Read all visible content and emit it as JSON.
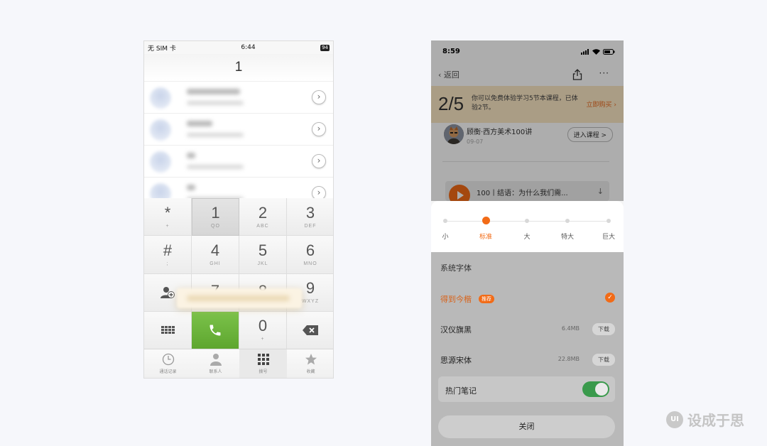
{
  "left_phone": {
    "status_bar": {
      "carrier": "无 SIM 卡",
      "time": "6:44",
      "battery": "94"
    },
    "dialed_number": "1",
    "keys": [
      {
        "num": "*",
        "sub": "+"
      },
      {
        "num": "1",
        "sub": "QO"
      },
      {
        "num": "2",
        "sub": "ABC"
      },
      {
        "num": "3",
        "sub": "DEF"
      },
      {
        "num": "#",
        "sub": ";"
      },
      {
        "num": "4",
        "sub": "GHI"
      },
      {
        "num": "5",
        "sub": "JKL"
      },
      {
        "num": "6",
        "sub": "MNO"
      },
      {
        "num": "",
        "sub": ""
      },
      {
        "num": "7",
        "sub": ""
      },
      {
        "num": "8",
        "sub": ""
      },
      {
        "num": "9",
        "sub": "WXYZ"
      },
      {
        "num": "",
        "sub": ""
      },
      {
        "num": "",
        "sub": ""
      },
      {
        "num": "0",
        "sub": "+"
      },
      {
        "num": "",
        "sub": ""
      }
    ],
    "tabs": [
      "通话记录",
      "联系人",
      "拨号",
      "收藏"
    ],
    "call_color": "#66ad35"
  },
  "right_phone": {
    "status_bar": {
      "time": "8:59"
    },
    "nav": {
      "back_label": "返回",
      "more_label": "···"
    },
    "trial_banner": {
      "count": "2/5",
      "text": "你可以免费体验学习5节本课程，已体验2节。",
      "buy_label": "立即购买"
    },
    "course": {
      "title": "顾衡·西方美术100讲",
      "date": "09-07",
      "enter_label": "进入课程 >"
    },
    "audio": {
      "title": "100丨结语：为什么我们需..."
    },
    "font_sizes": {
      "options": [
        "小",
        "标准",
        "大",
        "特大",
        "巨大"
      ],
      "selected": "标准"
    },
    "system_font_label": "系统字体",
    "fonts": [
      {
        "name": "得到今楷",
        "badge": "推荐",
        "size": "",
        "action": ""
      },
      {
        "name": "汉仪旗黑",
        "badge": "",
        "size": "6.4MB",
        "action": "下载"
      },
      {
        "name": "思源宋体",
        "badge": "",
        "size": "22.8MB",
        "action": "下载"
      }
    ],
    "hot_notes": {
      "label": "热门笔记",
      "enabled": true
    },
    "close_label": "关闭",
    "accent_color": "#f26b17"
  },
  "watermark": {
    "text": "设成于思"
  }
}
